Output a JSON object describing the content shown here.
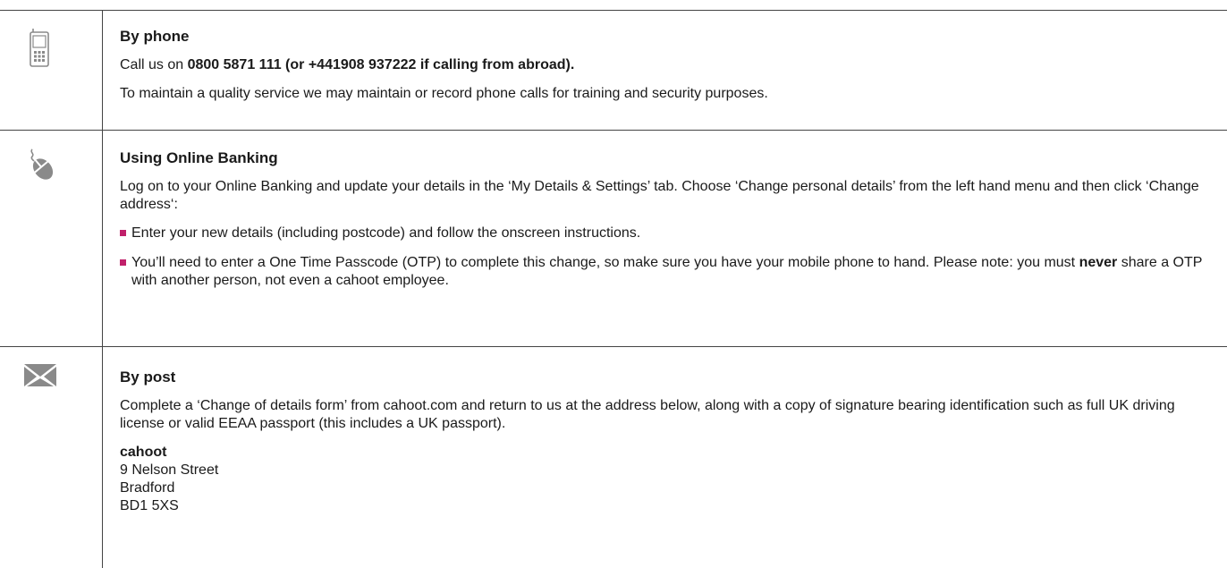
{
  "phone": {
    "heading": "By phone",
    "line1_prefix": "Call us on ",
    "line1_bold": "0800 5871 111 (or +441908 937222 if calling from abroad).",
    "line2": "To maintain a quality service we may maintain or record phone calls for training and security purposes."
  },
  "online": {
    "heading": "Using Online Banking",
    "intro": "Log on to your Online Banking and update your details in the ‘My Details & Settings’ tab. Choose ‘Change personal details’ from the left hand menu and then click ‘Change address‘:",
    "bullet1": "Enter your new details (including postcode) and follow the onscreen instructions.",
    "bullet2_part1": "You’ll need to enter a One Time Passcode (OTP) to complete this change, so make sure you have your mobile phone to hand. Please note: you must ",
    "bullet2_bold": "never",
    "bullet2_part2": " share a OTP with another person, not even a cahoot employee."
  },
  "post": {
    "heading": "By post",
    "intro": "Complete a ‘Change of details form’ from cahoot.com and return to us at the address below, along with a copy of signature bearing identification such as full UK driving license or valid EEAA passport (this includes a UK passport).",
    "address_name": "cahoot",
    "address_line1": "9 Nelson Street",
    "address_line2": "Bradford",
    "address_line3": "BD1 5XS"
  },
  "colors": {
    "bullet": "#c0206a",
    "icon": "#8a8a8a",
    "rule": "#444444"
  },
  "icons": {
    "phone": "mobile-phone-icon",
    "online": "computer-mouse-icon",
    "post": "envelope-icon"
  }
}
